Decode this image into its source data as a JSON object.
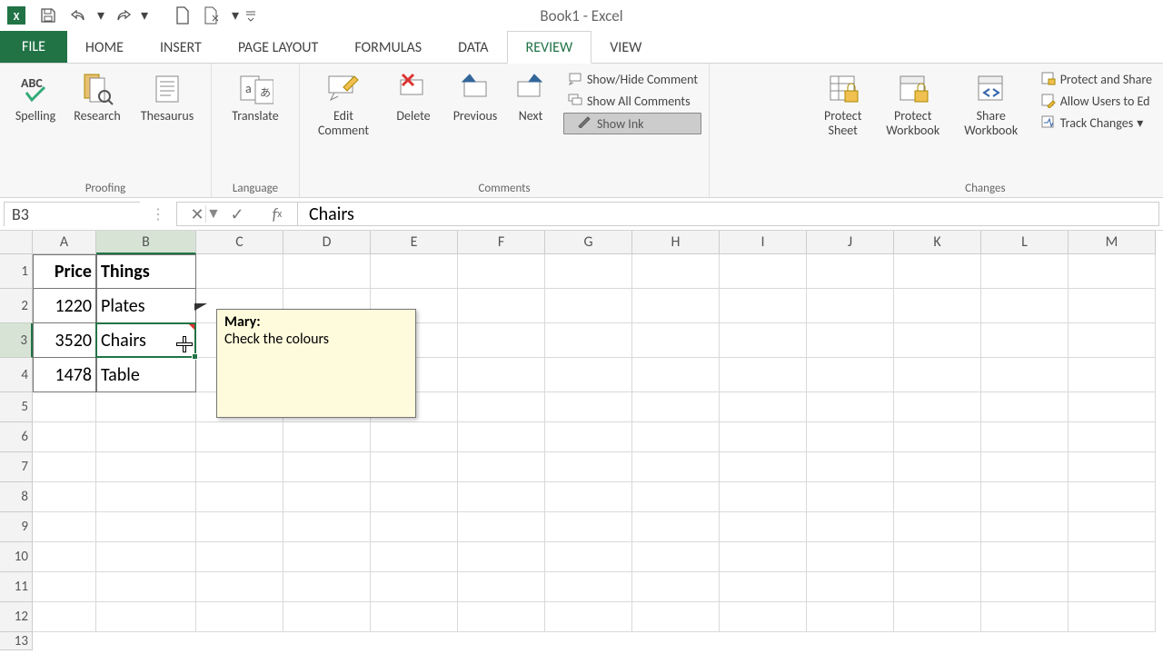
{
  "title": "Book1 - Excel",
  "tabs": {
    "file": "FILE",
    "items": [
      "HOME",
      "INSERT",
      "PAGE LAYOUT",
      "FORMULAS",
      "DATA",
      "REVIEW",
      "VIEW"
    ],
    "active": "REVIEW"
  },
  "ribbon": {
    "groups": {
      "proofing": {
        "label": "Proofing",
        "spelling": "Spelling",
        "research": "Research",
        "thesaurus": "Thesaurus"
      },
      "language": {
        "label": "Language",
        "translate": "Translate"
      },
      "comments": {
        "label": "Comments",
        "edit": "Edit Comment",
        "delete": "Delete",
        "previous": "Previous",
        "next": "Next",
        "show_hide": "Show/Hide Comment",
        "show_all": "Show All Comments",
        "show_ink": "Show Ink"
      },
      "changes": {
        "label": "Changes",
        "protect_sheet": "Protect Sheet",
        "protect_workbook": "Protect Workbook",
        "share_workbook": "Share Workbook",
        "protect_share": "Protect and Share",
        "allow_users": "Allow Users to Ed",
        "track_changes": "Track Changes"
      }
    }
  },
  "fbar": {
    "namebox": "B3",
    "formula": "Chairs"
  },
  "columns": [
    "A",
    "B",
    "C",
    "D",
    "E",
    "F",
    "G",
    "H",
    "I",
    "J",
    "K",
    "L",
    "M"
  ],
  "rows_visible": 13,
  "data_rows": [
    {
      "A": "Price",
      "B": "Things",
      "hdr": true
    },
    {
      "A": "1220",
      "B": "Plates"
    },
    {
      "A": "3520",
      "B": "Chairs"
    },
    {
      "A": "1478",
      "B": "Table"
    }
  ],
  "selected_cell": {
    "col": "B",
    "row": 3
  },
  "comment": {
    "cell": "B3",
    "author": "Mary:",
    "text": "Check the colours"
  }
}
